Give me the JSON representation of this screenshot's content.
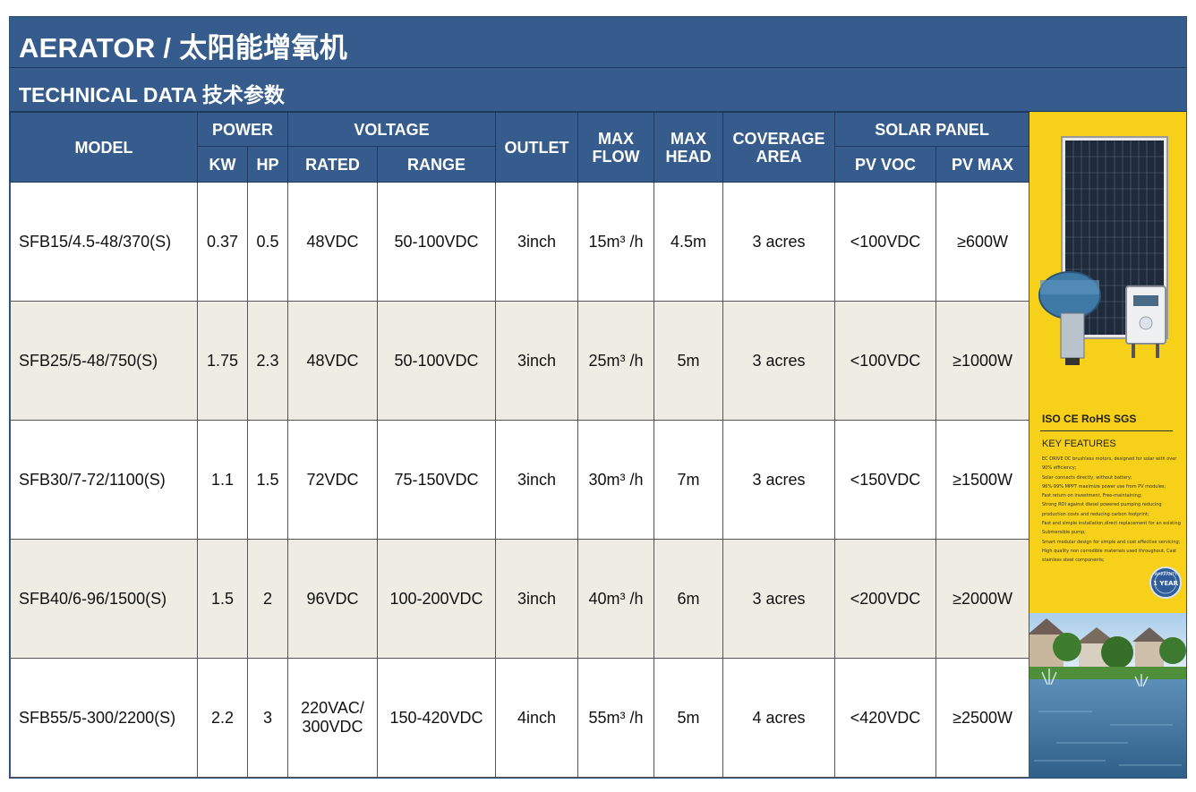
{
  "header": {
    "title": "AERATOR / 太阳能增氧机",
    "subtitle": "TECHNICAL DATA 技术参数"
  },
  "table": {
    "headers": {
      "model": "MODEL",
      "power": "POWER",
      "kw": "KW",
      "hp": "HP",
      "voltage": "VOLTAGE",
      "rated": "RATED",
      "range": "RANGE",
      "outlet": "OUTLET",
      "max_flow_1": "MAX",
      "max_flow_2": "FLOW",
      "max_head_1": "MAX",
      "max_head_2": "HEAD",
      "coverage_1": "COVERAGE",
      "coverage_2": "AREA",
      "solar_panel": "SOLAR PANEL",
      "pv_voc": "PV VOC",
      "pv_max": "PV MAX"
    },
    "rows": [
      {
        "model": "SFB15/4.5-48/370(S)",
        "kw": "0.37",
        "hp": "0.5",
        "rated": "48VDC",
        "rated2": "",
        "range": "50-100VDC",
        "outlet": "3inch",
        "flow": "15m³ /h",
        "head": "4.5m",
        "area": "3 acres",
        "pv_voc": "<100VDC",
        "pv_max": "≥600W"
      },
      {
        "model": "SFB25/5-48/750(S)",
        "kw": "1.75",
        "hp": "2.3",
        "rated": "48VDC",
        "rated2": "",
        "range": "50-100VDC",
        "outlet": "3inch",
        "flow": "25m³ /h",
        "head": "5m",
        "area": "3 acres",
        "pv_voc": "<100VDC",
        "pv_max": "≥1000W"
      },
      {
        "model": "SFB30/7-72/1100(S)",
        "kw": "1.1",
        "hp": "1.5",
        "rated": "72VDC",
        "rated2": "",
        "range": "75-150VDC",
        "outlet": "3inch",
        "flow": "30m³ /h",
        "head": "7m",
        "area": "3 acres",
        "pv_voc": "<150VDC",
        "pv_max": "≥1500W"
      },
      {
        "model": "SFB40/6-96/1500(S)",
        "kw": "1.5",
        "hp": "2",
        "rated": "96VDC",
        "rated2": "",
        "range": "100-200VDC",
        "outlet": "3inch",
        "flow": "40m³ /h",
        "head": "6m",
        "area": "3 acres",
        "pv_voc": "<200VDC",
        "pv_max": "≥2000W"
      },
      {
        "model": "SFB55/5-300/2200(S)",
        "kw": "2.2",
        "hp": "3",
        "rated": "220VAC/",
        "rated2": "300VDC",
        "range": "150-420VDC",
        "outlet": "4inch",
        "flow": "55m³ /h",
        "head": "5m",
        "area": "4 acres",
        "pv_voc": "<420VDC",
        "pv_max": "≥2500W"
      }
    ]
  },
  "side_panel": {
    "certifications": "ISO  CE  RoHS  SGS",
    "features_title": "KEY FEATURES",
    "features": [
      "EC DRIVE DC brushless motors, designed for solar with over 90% efficiency;",
      "Solar connects directly, without battery;",
      "96%-99% MPPT maximize power use from PV modules;",
      "Fast return on investment, Free-maintaining;",
      "Strong ROI against diesel powered pumping reducing production costs and reducing carbon footprint;",
      "Fast and simple installation,direct replacement for an existing Submersible pump;",
      "Smart modular design for simple and cost effective servicing;",
      "High quality non corrodible materials used throughout, Cast stainless steel components;"
    ],
    "warranty_badge": "1 YEAR",
    "warranty_top": "WARRANTY",
    "icons": [
      "solar-panel-icon",
      "aerator-pump-icon",
      "controller-box-icon",
      "pond-fountain-photo"
    ],
    "colors": {
      "header_blue": "#355c8d",
      "panel_yellow": "#f6d019",
      "alt_row": "#efede3"
    }
  }
}
